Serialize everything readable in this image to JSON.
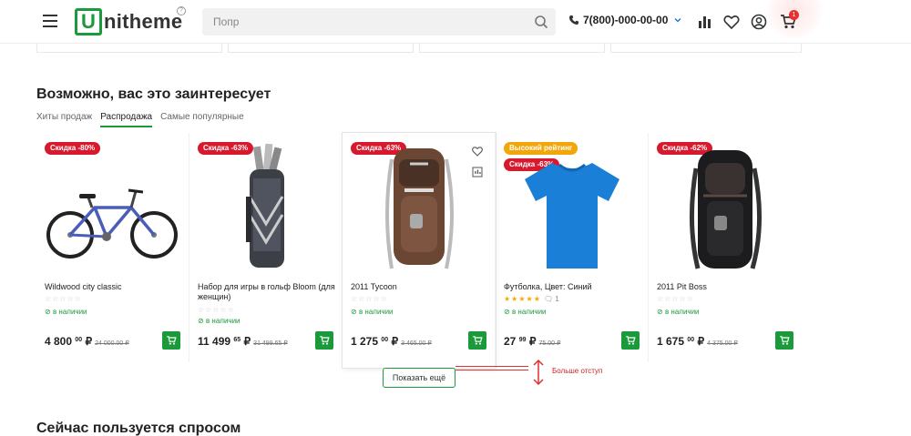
{
  "header": {
    "logo_letter": "U",
    "logo_text": "nitheme",
    "logo_badge": "?",
    "search_placeholder": "Попр",
    "phone": "7(800)-000-00-00",
    "cart_count": "1"
  },
  "section": {
    "title": "Возможно, вас это заинтересует",
    "tabs": [
      "Хиты продаж",
      "Распродажа",
      "Самые популярные"
    ],
    "active_tab": "Распродажа"
  },
  "products": [
    {
      "badges": [
        "Скидка -80%"
      ],
      "name": "Wildwood city classic",
      "rating": "☆☆☆☆☆",
      "stock": "в наличии",
      "price_main": "4 800",
      "price_cents": "00",
      "currency": "₽",
      "old_price": "24 000.00 ₽"
    },
    {
      "badges": [
        "Скидка -63%"
      ],
      "name": "Набор для игры в гольф Bloom (для женщин)",
      "rating": "☆☆☆☆☆",
      "stock": "в наличии",
      "price_main": "11 499",
      "price_cents": "65",
      "currency": "₽",
      "old_price": "31 499.65 ₽"
    },
    {
      "badges": [
        "Скидка -63%"
      ],
      "name": "2011 Tycoon",
      "rating": "☆☆☆☆☆",
      "stock": "в наличии",
      "price_main": "1 275",
      "price_cents": "00",
      "currency": "₽",
      "old_price": "3 465.00 ₽"
    },
    {
      "badges": [
        "Высокий рейтинг",
        "Скидка -63%"
      ],
      "name": "Футболка, Цвет: Синий",
      "rating": "★★★★★",
      "reviews": "1",
      "stock": "в наличии",
      "price_main": "27",
      "price_cents": "99",
      "currency": "₽",
      "old_price": "75.00 ₽"
    },
    {
      "badges": [
        "Скидка -62%"
      ],
      "name": "2011 Pit Boss",
      "rating": "☆☆☆☆☆",
      "stock": "в наличии",
      "price_main": "1 675",
      "price_cents": "00",
      "currency": "₽",
      "old_price": "4 375.00 ₽"
    }
  ],
  "show_more": "Показать ещё",
  "annotation": "Больше отступ",
  "next_section_title": "Сейчас пользуется спросом",
  "colors": {
    "accent": "#1a9a3a",
    "sale_badge": "#d8192d",
    "rating_badge": "#f3a60a",
    "cart_count": "#e8302e"
  }
}
